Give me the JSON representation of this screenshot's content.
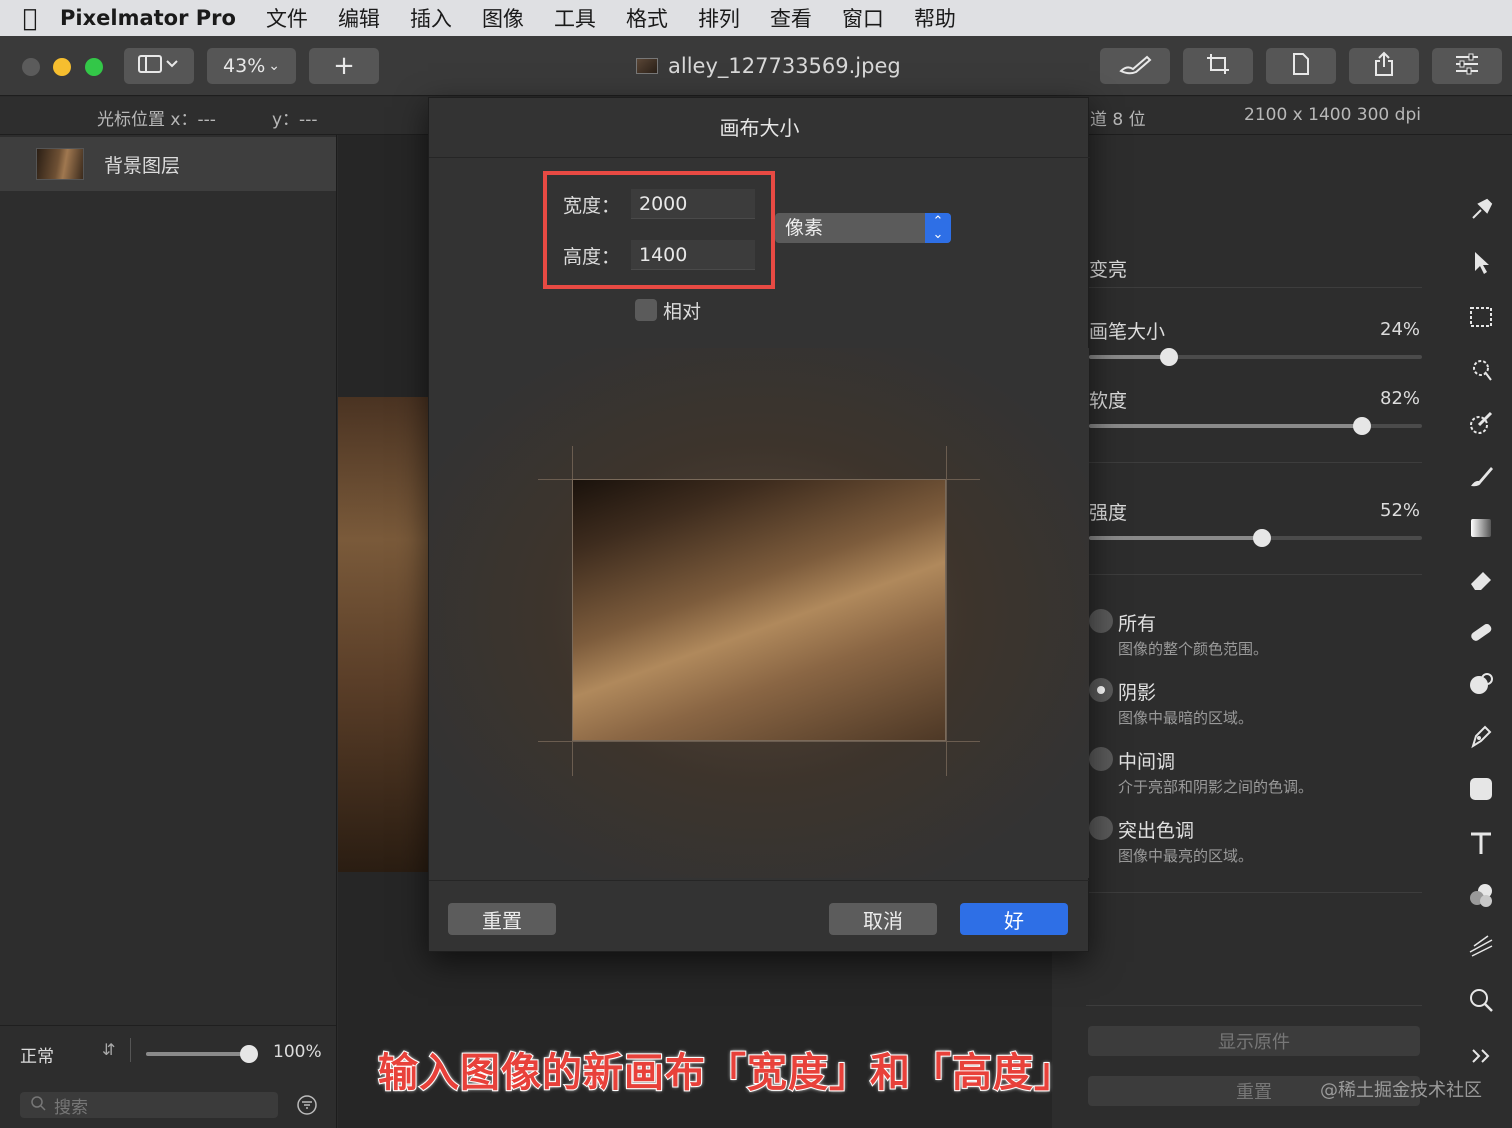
{
  "menubar": {
    "app_name": "Pixelmator Pro",
    "items": [
      "文件",
      "编辑",
      "插入",
      "图像",
      "工具",
      "格式",
      "排列",
      "查看",
      "窗口",
      "帮助"
    ]
  },
  "toolbar": {
    "zoom": "43%",
    "add_label": "+",
    "doc_title": "alley_127733569.jpeg"
  },
  "infobar": {
    "cursor_x_label": "光标位置 x：---",
    "cursor_y_label": "y：---",
    "channel_label": "道 8 位",
    "dimensions": "2100 x 1400 300 dpi"
  },
  "layers": {
    "items": [
      {
        "name": "背景图层"
      }
    ],
    "blend_mode": "正常",
    "opacity": "100%",
    "opacity_fraction": 0.95,
    "search_placeholder": "搜索"
  },
  "dialog": {
    "title": "画布大小",
    "width_label": "宽度：",
    "width_value": "2000",
    "height_label": "高度：",
    "height_value": "1400",
    "unit": "像素",
    "relative_label": "相对",
    "relative_checked": false,
    "reset_label": "重置",
    "cancel_label": "取消",
    "ok_label": "好"
  },
  "right_panel": {
    "mode_label": "变亮",
    "sliders": [
      {
        "label": "画笔大小",
        "value": "24%",
        "fraction": 0.24
      },
      {
        "label": "软度",
        "value": "82%",
        "fraction": 0.82
      },
      {
        "label": "强度",
        "value": "52%",
        "fraction": 0.52
      }
    ],
    "ranges": [
      {
        "title": "所有",
        "desc": "图像的整个颜色范围。",
        "selected": false
      },
      {
        "title": "阴影",
        "desc": "图像中最暗的区域。",
        "selected": true
      },
      {
        "title": "中间调",
        "desc": "介于亮部和阴影之间的色调。",
        "selected": false
      },
      {
        "title": "突出色调",
        "desc": "图像中最亮的区域。",
        "selected": false
      }
    ],
    "show_original_label": "显示原件",
    "reset_label": "重置"
  },
  "tools": [
    "style-tool-icon",
    "arrow-select-icon",
    "rect-select-icon",
    "magic-select-icon",
    "color-pick-icon",
    "brush-icon",
    "gradient-icon",
    "eraser-icon",
    "repair-icon",
    "retouch-icon",
    "pen-icon",
    "shape-icon",
    "type-icon",
    "color-adjust-icon",
    "distort-icon",
    "zoom-icon",
    "more-icon"
  ],
  "caption": "输入图像的新画布「宽度」和「高度」",
  "watermark": "@稀土掘金技术社区",
  "colors": {
    "accent": "#2e6fe6",
    "highlight_border": "#e84a43",
    "caption": "#e8413a"
  }
}
